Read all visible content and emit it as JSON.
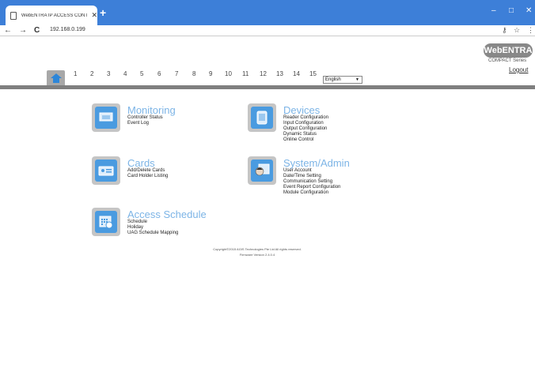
{
  "browser": {
    "tab_title": "WebENTRA IP ACCESS CONTROL",
    "url": "192.168.0.199",
    "controls": {
      "minimize": "–",
      "maximize": "□",
      "close": "✕"
    }
  },
  "header": {
    "brand": "WebENTRA",
    "brand_sub": "COMPACT Series",
    "logout": "Logout"
  },
  "tabs": [
    "1",
    "2",
    "3",
    "4",
    "5",
    "6",
    "7",
    "8",
    "9",
    "10",
    "11",
    "12",
    "13",
    "14",
    "15"
  ],
  "language": {
    "selected": "English"
  },
  "menu": {
    "monitoring": {
      "title": "Monitoring",
      "items": [
        "Controller Status",
        "Event Log"
      ]
    },
    "devices": {
      "title": "Devices",
      "items": [
        "Reader Configuration",
        "Input Configuration",
        "Output Configuration",
        "Dynamic Status",
        "Online Control"
      ]
    },
    "cards": {
      "title": "Cards",
      "items": [
        "Add/Delete Cards",
        "Card Holder Listing"
      ]
    },
    "system": {
      "title": "System/Admin",
      "items": [
        "User Account",
        "Date/Time Setting",
        "Communication Setting",
        "Event Report Configuration",
        "Module Configuration"
      ]
    },
    "access": {
      "title": "Access Schedule",
      "items": [
        "Schedule",
        "Holiday",
        "UAG Schedule Mapping"
      ]
    }
  },
  "footer": {
    "copyright": "Copyright©2015 AGIS Technologies Pte Ltd All rights reserved.",
    "firmware": "Firmware Version 2.4.0.4"
  },
  "colors": {
    "accent": "#4a9be0",
    "title": "#7cb4e6",
    "chrome": "#3d7fd8"
  }
}
